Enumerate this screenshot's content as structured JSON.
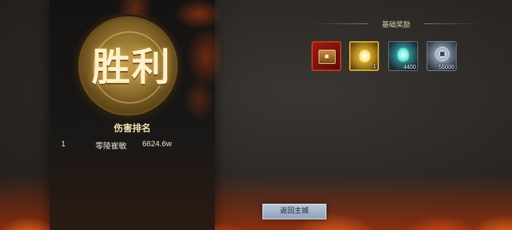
{
  "result": {
    "title": "胜利"
  },
  "ranking": {
    "title": "伤害排名",
    "rows": [
      {
        "rank": "1",
        "name": "零陵崔敏",
        "damage": "6624.6w"
      }
    ]
  },
  "rewards": {
    "title": "基础奖励",
    "items": [
      {
        "icon": "treasure-chest-icon",
        "quantity": ""
      },
      {
        "icon": "golden-spirit-icon",
        "quantity": "1"
      },
      {
        "icon": "soul-orb-icon",
        "quantity": "4400"
      },
      {
        "icon": "coin-icon",
        "quantity": "55000"
      }
    ]
  },
  "actions": {
    "return_label": "返回主城"
  },
  "colors": {
    "accent_gold": "#fdf0c8",
    "fire": "#ff7a1e",
    "button": "#a8b8cc"
  }
}
